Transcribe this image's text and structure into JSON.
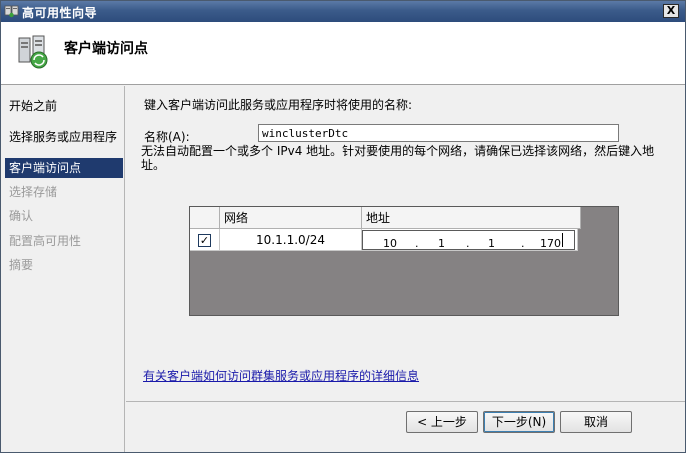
{
  "window": {
    "title": "高可用性向导",
    "close_label": "X"
  },
  "header": {
    "heading": "客户端访问点"
  },
  "nav": {
    "items": [
      {
        "label": "开始之前",
        "state": "normal"
      },
      {
        "label": "选择服务或应用程序",
        "state": "normal"
      },
      {
        "label": "客户端访问点",
        "state": "selected"
      },
      {
        "label": "选择存储",
        "state": "disabled"
      },
      {
        "label": "确认",
        "state": "disabled"
      },
      {
        "label": "配置高可用性",
        "state": "disabled"
      },
      {
        "label": "摘要",
        "state": "disabled"
      }
    ]
  },
  "main": {
    "instruction": "键入客户端访问此服务或应用程序时将使用的名称:",
    "name_label": "名称(A):",
    "name_value": "winclusterDtc",
    "notice": "无法自动配置一个或多个 IPv4 地址。针对要使用的每个网络，请确保已选择该网络，然后键入地址。",
    "grid": {
      "columns": [
        "网络",
        "地址"
      ],
      "rows": [
        {
          "checked": true,
          "check_mark": "✓",
          "network": "10.1.1.0/24",
          "address": [
            "10",
            "1",
            "1",
            "170"
          ]
        }
      ]
    },
    "link_text": "有关客户端如何访问群集服务或应用程序的详细信息"
  },
  "footer": {
    "back_label": "< 上一步",
    "next_label": "下一步(N)",
    "cancel_label": "取消"
  },
  "colors": {
    "title_bar": "#2d4c7c",
    "nav_selected": "#1f3a6e",
    "grid_background": "#858283",
    "link": "#1a1aaa"
  }
}
